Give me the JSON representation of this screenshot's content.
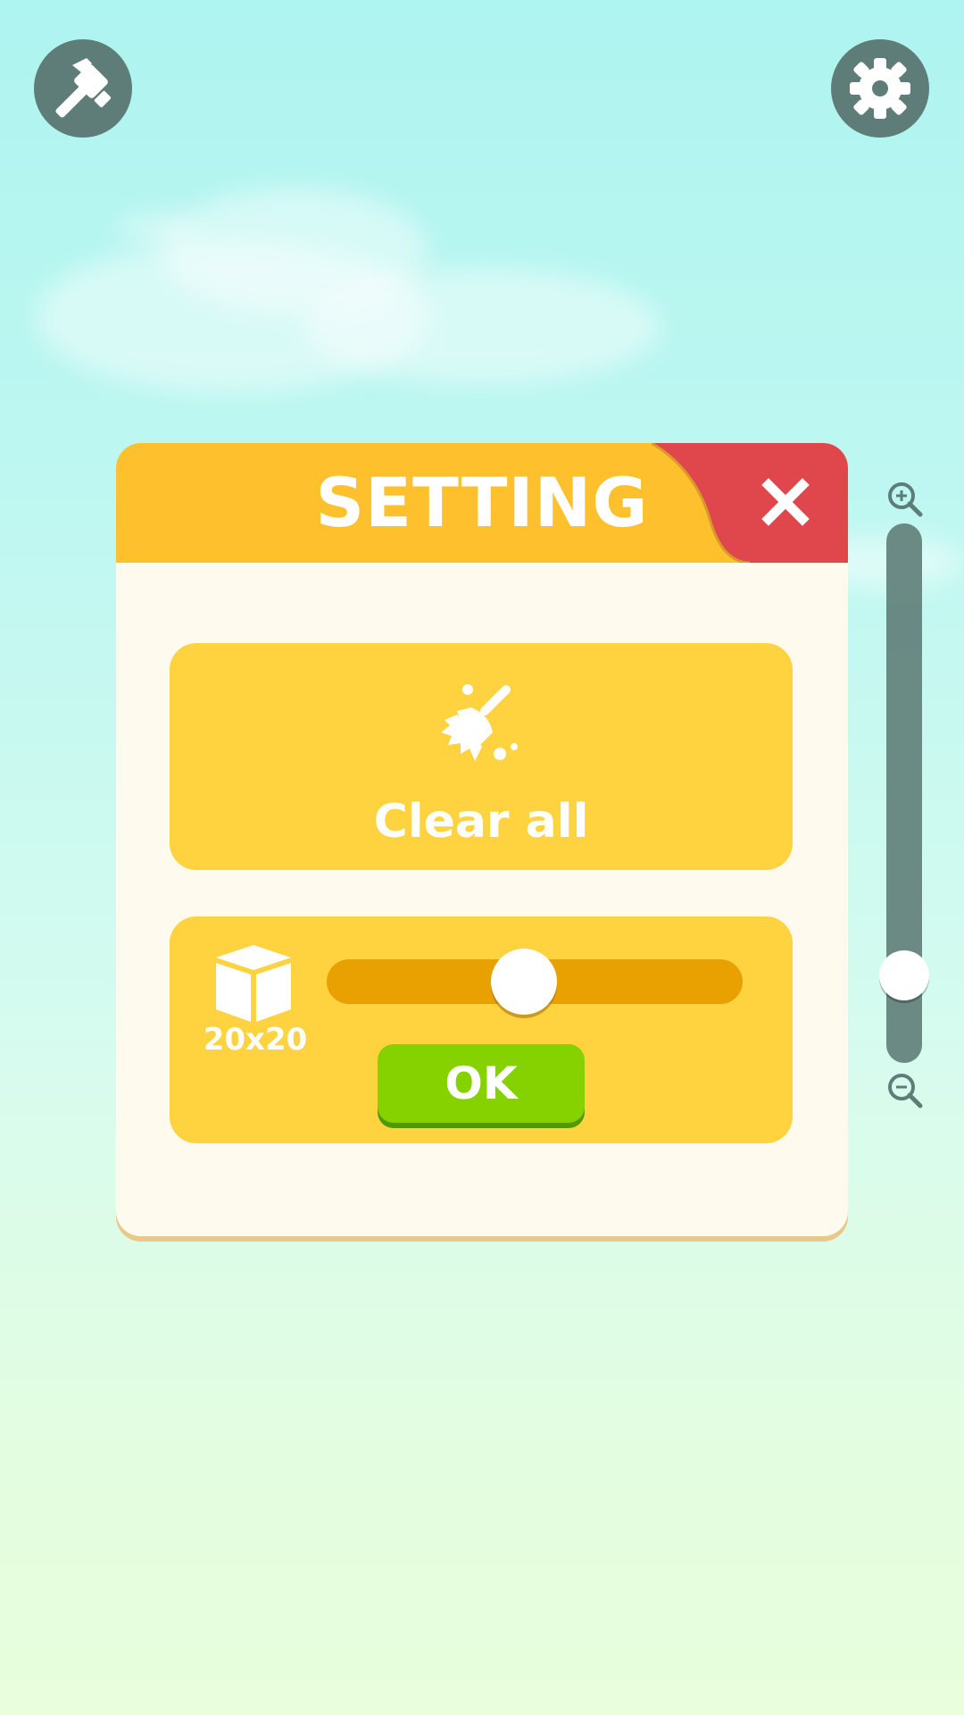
{
  "topbar": {
    "left_icon": "hammer-icon",
    "right_icon": "gear-icon"
  },
  "dialog": {
    "title": "SETTING",
    "close_icon": "close-icon",
    "clear_card": {
      "icon": "broom-icon",
      "label": "Clear all"
    },
    "size_card": {
      "icon": "cube-icon",
      "size_label": "20x20",
      "slider_value": 0.47,
      "ok_label": "OK"
    }
  },
  "zoom": {
    "zoom_in_icon": "zoom-in-icon",
    "zoom_out_icon": "zoom-out-icon",
    "level": 0.12
  },
  "colors": {
    "header": "#ffc02e",
    "close": "#e0474c",
    "card": "#ffd23f",
    "track": "#e8a100",
    "ok": "#86d100",
    "dark_button": "#5f7d78"
  }
}
